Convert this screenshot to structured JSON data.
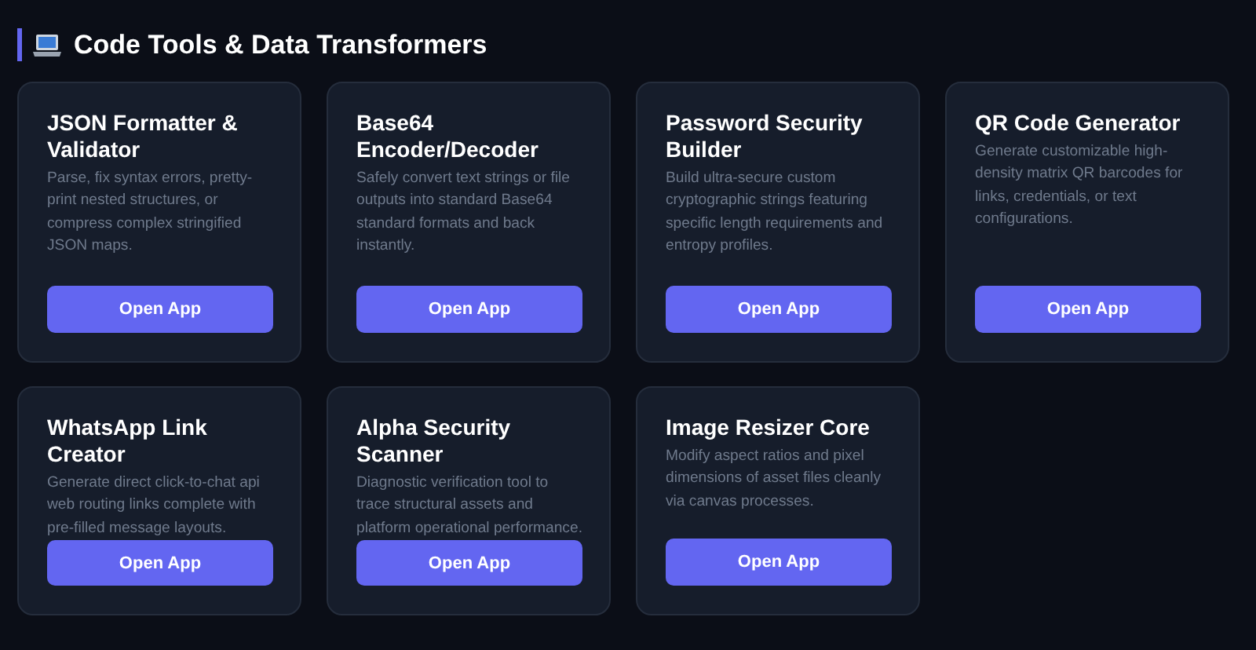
{
  "section": {
    "title": "Code Tools & Data Transformers"
  },
  "tools": [
    {
      "title": "JSON Formatter & Validator",
      "description": "Parse, fix syntax errors, pretty-print nested structures, or compress complex stringified JSON maps.",
      "button": "Open App"
    },
    {
      "title": "Base64 Encoder/Decoder",
      "description": "Safely convert text strings or file outputs into standard Base64 standard formats and back instantly.",
      "button": "Open App"
    },
    {
      "title": "Password Security Builder",
      "description": "Build ultra-secure custom cryptographic strings featuring specific length requirements and entropy profiles.",
      "button": "Open App"
    },
    {
      "title": "QR Code Generator",
      "description": "Generate customizable high-density matrix QR barcodes for links, credentials, or text configurations.",
      "button": "Open App"
    },
    {
      "title": "WhatsApp Link Creator",
      "description": "Generate direct click-to-chat api web routing links complete with pre-filled message layouts.",
      "button": "Open App"
    },
    {
      "title": "Alpha Security Scanner",
      "description": "Diagnostic verification tool to trace structural assets and platform operational performance.",
      "button": "Open App"
    },
    {
      "title": "Image Resizer Core",
      "description": "Modify aspect ratios and pixel dimensions of asset files cleanly via canvas processes.",
      "button": "Open App"
    }
  ]
}
